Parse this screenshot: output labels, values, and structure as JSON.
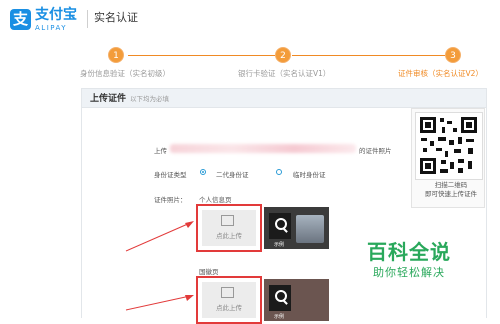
{
  "header": {
    "logo_glyph": "支",
    "logo_cn": "支付宝",
    "logo_en": "ALIPAY",
    "title": "实名认证"
  },
  "steps": [
    {
      "num": "1",
      "label": "身份信息验证（实名初级）"
    },
    {
      "num": "2",
      "label": "银行卡验证（实名认证V1）"
    },
    {
      "num": "3",
      "label": "证件审核（实名认证V2）"
    }
  ],
  "section": {
    "title": "上传证件",
    "subtitle": "以下均为必填"
  },
  "form": {
    "upload_prefix": "上传",
    "upload_suffix": "的证件照片",
    "id_type_label": "身份证类型",
    "id_type_options": [
      "二代身份证",
      "临时身份证"
    ],
    "id_type_selected": "二代身份证",
    "photo_label": "证件照片：",
    "front_label": "个人信息页",
    "back_label": "国徽页",
    "upload_button": "点此上传",
    "sample_label": "示例"
  },
  "qr": {
    "line1": "扫描二维码",
    "line2": "即可快速上传证件"
  },
  "watermark": {
    "title": "百科全说",
    "subtitle": "助你轻松解决"
  },
  "colors": {
    "brand": "#1a8fe3",
    "progress": "#f08a24",
    "highlight": "#e23a3a",
    "watermark": "#29a85b"
  }
}
